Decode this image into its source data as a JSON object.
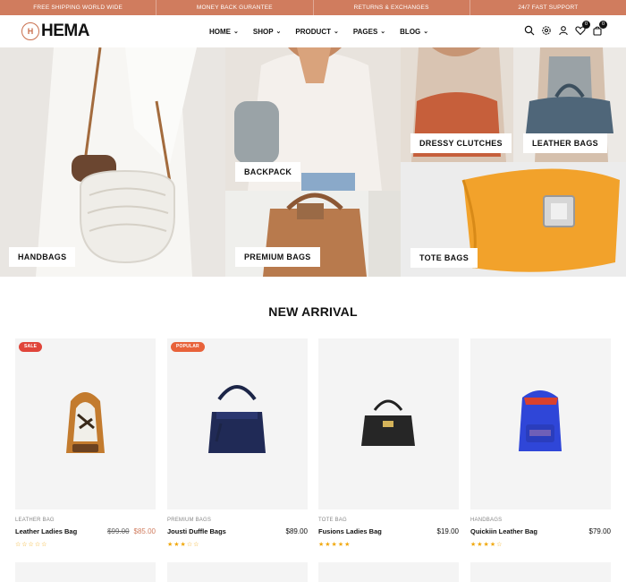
{
  "topbar": {
    "items": [
      "FREE SHIPPING WORLD WIDE",
      "MONEY BACK GURANTEE",
      "RETURNS & EXCHANGES",
      "24/7 FAST SUPPORT"
    ]
  },
  "header": {
    "logo_text": "HEMA",
    "nav": [
      {
        "label": "HOME"
      },
      {
        "label": "SHOP"
      },
      {
        "label": "PRODUCT"
      },
      {
        "label": "PAGES"
      },
      {
        "label": "BLOG"
      }
    ],
    "icons": [
      "search-icon",
      "settings-icon",
      "user-icon",
      "wishlist-icon",
      "cart-icon"
    ],
    "wishlist_count": "0",
    "cart_count": "0"
  },
  "hero": {
    "tiles": [
      {
        "label": "HANDBAGS"
      },
      {
        "label": "BACKPACK"
      },
      {
        "label": "PREMIUM BAGS"
      },
      {
        "label": "DRESSY CLUTCHES"
      },
      {
        "label": "LEATHER BAGS"
      },
      {
        "label": "TOTE BAGS"
      }
    ]
  },
  "section": {
    "title": "NEW ARRIVAL"
  },
  "products": [
    {
      "tag": "SALE",
      "tag_color": "#e0453a",
      "category": "LEATHER BAG",
      "name": "Leather Ladies Bag",
      "old_price": "$99.00",
      "price": "$85.00",
      "rating": 0
    },
    {
      "tag": "POPULAR",
      "tag_color": "#e8623a",
      "category": "PREMIUM BAGS",
      "name": "Jousti Duffle Bags",
      "old_price": "",
      "price": "$89.00",
      "rating": 3
    },
    {
      "tag": "",
      "tag_color": "",
      "category": "TOTE BAG",
      "name": "Fusions Ladies Bag",
      "old_price": "",
      "price": "$19.00",
      "rating": 5
    },
    {
      "tag": "",
      "tag_color": "",
      "category": "HANDBAGS",
      "name": "Quickiin Leather Bag",
      "old_price": "",
      "price": "$79.00",
      "rating": 4
    }
  ],
  "colors": {
    "accent": "#d07c5e",
    "star": "#f1a910"
  }
}
